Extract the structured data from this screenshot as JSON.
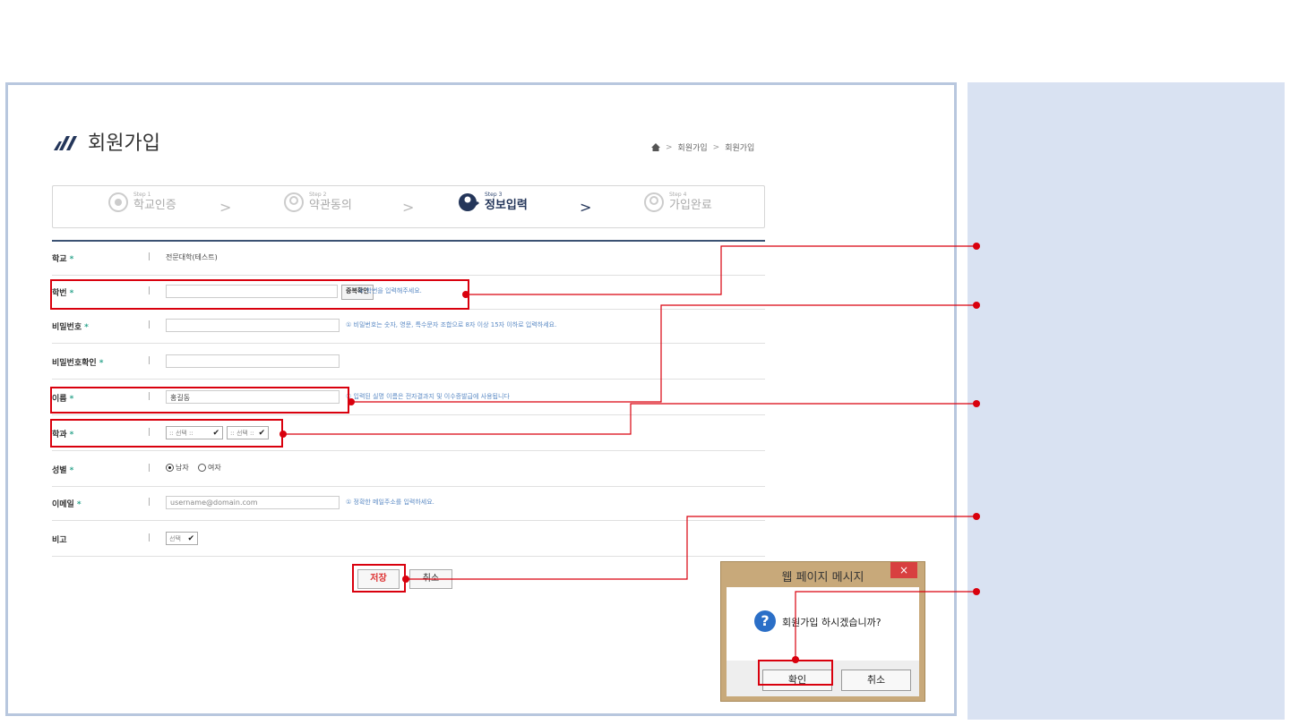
{
  "page": {
    "title": "회원가입",
    "accent": "#24365a",
    "highlight": "#d9000d"
  },
  "breadcrumb": {
    "home_icon": "home-icon",
    "items": [
      "회원가입",
      "회원가입"
    ]
  },
  "steps": [
    {
      "num": "Step 1",
      "name": "학교인증",
      "active": false
    },
    {
      "num": "Step 2",
      "name": "약관동의",
      "active": false
    },
    {
      "num": "Step 3",
      "name": "정보입력",
      "active": true
    },
    {
      "num": "Step 4",
      "name": "가입완료",
      "active": false
    }
  ],
  "form": {
    "school": {
      "label": "학교",
      "value": "전문대학(테스트)"
    },
    "student_id": {
      "label": "학번",
      "value": "",
      "button": "중복확인",
      "hint": "① 학번을 입력해주세요."
    },
    "password": {
      "label": "비밀번호",
      "value": "",
      "hint": "① 비밀번호는 숫자, 영문, 특수문자 조합으로 8자 이상 15자 이하로 입력하세요."
    },
    "password_confirm": {
      "label": "비밀번호확인",
      "value": ""
    },
    "name": {
      "label": "이름",
      "value": "홍길동",
      "hint": "① 입력된 실명 이름은 전자결과지 및 이수증발급에 사용됩니다"
    },
    "department": {
      "label": "학과",
      "select1": ":: 선택 ::",
      "select2": ":: 선택 ::"
    },
    "gender": {
      "label": "성별",
      "options": [
        "남자",
        "여자"
      ],
      "selected": "남자"
    },
    "email": {
      "label": "이메일",
      "placeholder": "username@domain.com",
      "hint": "① 정확한 메일주소를 입력하세요."
    },
    "note": {
      "label": "비고",
      "select": "선택"
    },
    "required_mark": "*",
    "bar": "|"
  },
  "actions": {
    "save": "저장",
    "cancel": "취소"
  },
  "dialog": {
    "title": "웹 페이지 메시지",
    "close": "×",
    "message": "회원가입 하시겠습니까?",
    "ok": "확인",
    "cancel": "취소",
    "icon": "question-icon"
  }
}
